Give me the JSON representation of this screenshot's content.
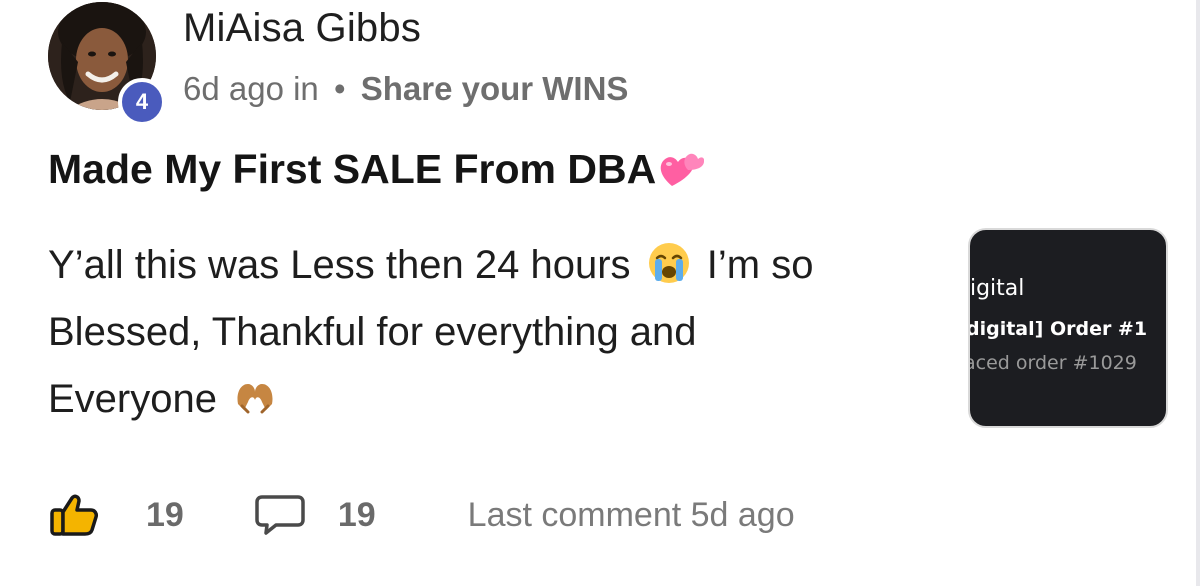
{
  "post": {
    "author": "MiAisa Gibbs",
    "level": "4",
    "time": "6d ago in",
    "separator": "•",
    "category": "Share your WINS",
    "title": "Made My First SALE From DBA",
    "title_emoji": "two-hearts-emoji",
    "body_line1": "Y’all this was Less then 24 hours",
    "body_emoji1": "loudly-crying-face-emoji",
    "body_line1_end": "I’m so",
    "body_line2": "Blessed, Thankful for everything and",
    "body_line3": "Everyone",
    "body_emoji2": "heart-hands-emoji",
    "thumbnail": {
      "line1": "digital",
      "line2": "digital] Order #1",
      "line3": "aced order #1029"
    }
  },
  "footer": {
    "likes": "19",
    "comments": "19",
    "last_comment": "Last comment 5d ago"
  },
  "colors": {
    "badge": "#4a5bbd",
    "text": "#1a1a1a",
    "muted": "#6e6e6e",
    "thumb_bg": "#1c1d21"
  }
}
